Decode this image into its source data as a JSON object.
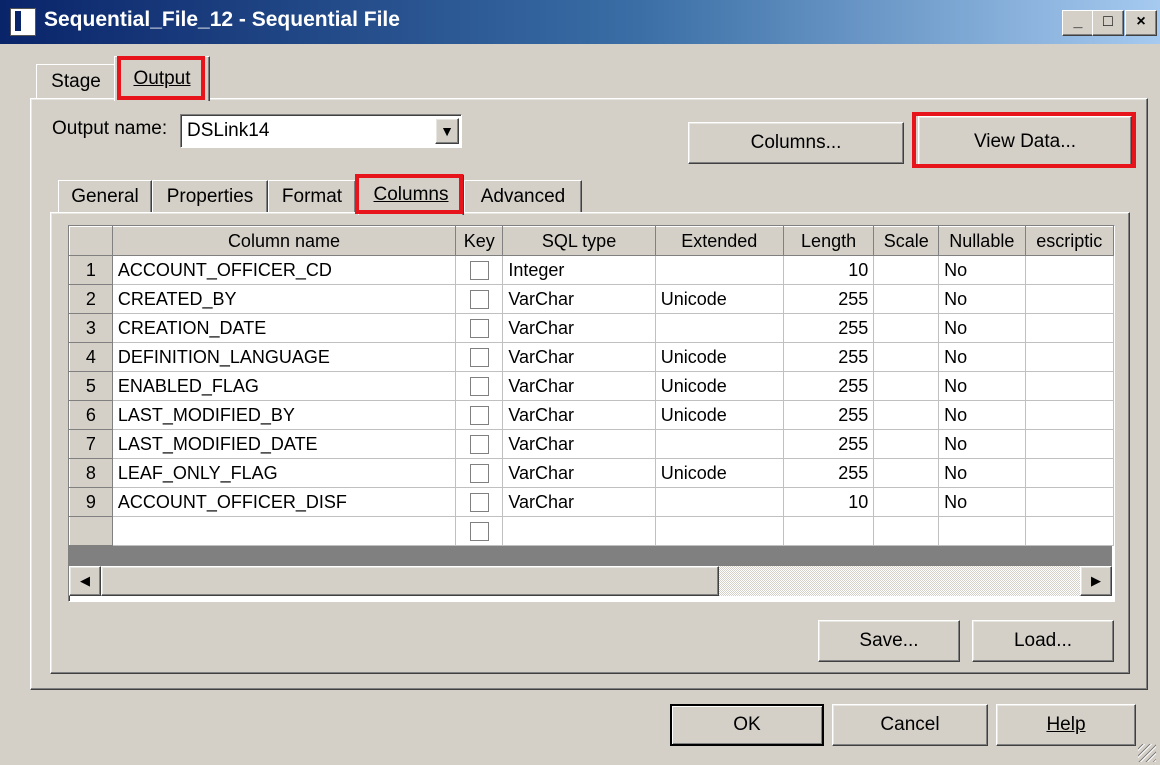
{
  "window": {
    "title": "Sequential_File_12 - Sequential File",
    "minimize_glyph": "_",
    "maximize_glyph": "□",
    "close_glyph": "×"
  },
  "outer_tabs": [
    {
      "label": "Stage",
      "active": false
    },
    {
      "label": "Output",
      "active": true,
      "highlighted": true
    }
  ],
  "output": {
    "name_label": "Output name:",
    "name_value": "DSLink14",
    "columns_button": "Columns...",
    "view_data_button": "View Data..."
  },
  "inner_tabs": [
    {
      "label": "General"
    },
    {
      "label": "Properties"
    },
    {
      "label": "Format"
    },
    {
      "label": "Columns",
      "active": true
    },
    {
      "label": "Advanced"
    }
  ],
  "table": {
    "headers": [
      "Column name",
      "Key",
      "SQL type",
      "Extended",
      "Length",
      "Scale",
      "Nullable",
      "escriptic"
    ],
    "rows": [
      {
        "num": "1",
        "name": "ACCOUNT_OFFICER_CD",
        "sql_type": "Integer",
        "extended": "",
        "length": "10",
        "scale": "",
        "nullable": "No"
      },
      {
        "num": "2",
        "name": "CREATED_BY",
        "sql_type": "VarChar",
        "extended": "Unicode",
        "length": "255",
        "scale": "",
        "nullable": "No"
      },
      {
        "num": "3",
        "name": "CREATION_DATE",
        "sql_type": "VarChar",
        "extended": "",
        "length": "255",
        "scale": "",
        "nullable": "No"
      },
      {
        "num": "4",
        "name": "DEFINITION_LANGUAGE",
        "sql_type": "VarChar",
        "extended": "Unicode",
        "length": "255",
        "scale": "",
        "nullable": "No"
      },
      {
        "num": "5",
        "name": "ENABLED_FLAG",
        "sql_type": "VarChar",
        "extended": "Unicode",
        "length": "255",
        "scale": "",
        "nullable": "No"
      },
      {
        "num": "6",
        "name": "LAST_MODIFIED_BY",
        "sql_type": "VarChar",
        "extended": "Unicode",
        "length": "255",
        "scale": "",
        "nullable": "No"
      },
      {
        "num": "7",
        "name": "LAST_MODIFIED_DATE",
        "sql_type": "VarChar",
        "extended": "",
        "length": "255",
        "scale": "",
        "nullable": "No"
      },
      {
        "num": "8",
        "name": "LEAF_ONLY_FLAG",
        "sql_type": "VarChar",
        "extended": "Unicode",
        "length": "255",
        "scale": "",
        "nullable": "No"
      },
      {
        "num": "9",
        "name": "ACCOUNT_OFFICER_DISF",
        "sql_type": "VarChar",
        "extended": "",
        "length": "10",
        "scale": "",
        "nullable": "No"
      }
    ]
  },
  "buttons": {
    "save": "Save...",
    "load": "Load...",
    "ok": "OK",
    "cancel": "Cancel",
    "help": "Help"
  },
  "icons": {
    "app": "sequential-file-icon",
    "dropdown": "chevron-down-icon",
    "scroll_left": "arrow-left-icon",
    "scroll_right": "arrow-right-icon"
  },
  "colors": {
    "titlebar_start": "#0a246a",
    "titlebar_end": "#a6caf0",
    "highlight": "#e8141c",
    "face": "#d4d0c8"
  }
}
